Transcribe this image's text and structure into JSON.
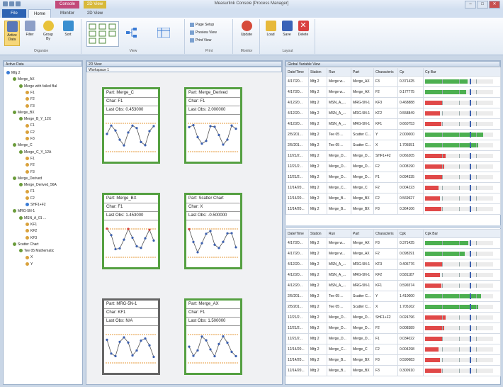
{
  "app": {
    "title": "Measurlink Console [Process Manager]",
    "context_tabs": [
      {
        "label": "Console",
        "color": "#c24a7a"
      },
      {
        "label": "2D View",
        "color": "#d8b93a"
      }
    ]
  },
  "tabs": [
    "File",
    "Home",
    "Monitor",
    "2D View"
  ],
  "ribbon": {
    "groups": [
      {
        "label": "Organize",
        "buttons": [
          "Active Data",
          "Filter",
          "Group By",
          "Sort"
        ]
      },
      {
        "label": "View",
        "buttons": []
      },
      {
        "label": "Print",
        "buttons": [
          "Page Setup",
          "Preview View",
          "Print View"
        ]
      },
      {
        "label": "Monitor",
        "buttons": [
          "Update"
        ]
      },
      {
        "label": "Layout",
        "buttons": [
          "Load",
          "Save",
          "Delete"
        ]
      }
    ]
  },
  "left_panel": {
    "title": "Active Data",
    "tree": [
      {
        "label": "Mfg 2",
        "level": 0,
        "color": "#3a7bd5"
      },
      {
        "label": "Merge_AX",
        "level": 1,
        "color": "#6a9b3a"
      },
      {
        "label": "Merge with failed Bal",
        "level": 2,
        "color": "#6a9b3a"
      },
      {
        "label": "F1",
        "level": 3,
        "color": "#d9a13b"
      },
      {
        "label": "F2",
        "level": 3,
        "color": "#d9a13b"
      },
      {
        "label": "F3",
        "level": 3,
        "color": "#d9a13b"
      },
      {
        "label": "Merge_BX",
        "level": 1,
        "color": "#6a9b3a"
      },
      {
        "label": "Merge_B_Y_12X",
        "level": 2,
        "color": "#6a9b3a"
      },
      {
        "label": "F1",
        "level": 3,
        "color": "#d9a13b"
      },
      {
        "label": "F2",
        "level": 3,
        "color": "#d9a13b"
      },
      {
        "label": "F3",
        "level": 3,
        "color": "#d9a13b"
      },
      {
        "label": "Merge_C",
        "level": 1,
        "color": "#6a9b3a"
      },
      {
        "label": "Merge_C_Y_12A",
        "level": 2,
        "color": "#6a9b3a"
      },
      {
        "label": "F1",
        "level": 3,
        "color": "#d9a13b"
      },
      {
        "label": "F2",
        "level": 3,
        "color": "#d9a13b"
      },
      {
        "label": "F3",
        "level": 3,
        "color": "#d9a13b"
      },
      {
        "label": "Merge_Derived",
        "level": 1,
        "color": "#6a9b3a"
      },
      {
        "label": "Merge_Derived_56A",
        "level": 2,
        "color": "#6a9b3a"
      },
      {
        "label": "F1",
        "level": 3,
        "color": "#d9a13b"
      },
      {
        "label": "F2",
        "level": 3,
        "color": "#d9a13b"
      },
      {
        "label": "SHF1+F2",
        "level": 3,
        "color": "#3a7bd5"
      },
      {
        "label": "MRG-5N-1",
        "level": 1,
        "color": "#6a9b3a"
      },
      {
        "label": "MSN_A_01 ...",
        "level": 2,
        "color": "#6a9b3a"
      },
      {
        "label": "KF1",
        "level": 3,
        "color": "#d9a13b"
      },
      {
        "label": "KF2",
        "level": 3,
        "color": "#d9a13b"
      },
      {
        "label": "KF3",
        "level": 3,
        "color": "#d9a13b"
      },
      {
        "label": "Scatter Chart",
        "level": 1,
        "color": "#6a9b3a"
      },
      {
        "label": "Tee 05 Mathematic",
        "level": 2,
        "color": "#6a9b3a"
      },
      {
        "label": "X",
        "level": 3,
        "color": "#d9a13b"
      },
      {
        "label": "Y",
        "level": 3,
        "color": "#d9a13b"
      }
    ]
  },
  "mid_panel": {
    "title": "2D View",
    "subtitle": "Workspace 1",
    "cards": [
      {
        "part": "Part: Merge_C",
        "char": "Char: F1",
        "last": "Last Obs: 0.453000",
        "border": "green"
      },
      {
        "part": "Part: Merge_Derived",
        "char": "Char: F1",
        "last": "Last Obs: 2.000000",
        "border": "green"
      },
      {
        "part": "Part: Merge_BX",
        "char": "Char: F1",
        "last": "Last Obs: 1.453000",
        "border": "green"
      },
      {
        "part": "Part: Scatter Chart",
        "char": "Char: X",
        "last": "Last Obs: -0.500000",
        "border": "green"
      },
      {
        "part": "Part: MRG-5N-1",
        "char": "Char: KF1",
        "last": "Last Obs: N/A",
        "border": "gray"
      },
      {
        "part": "Part: Merge_AX",
        "char": "Char: F1",
        "last": "Last Obs: 1.500000",
        "border": "green"
      }
    ]
  },
  "right_panel": {
    "title": "Global Variable View",
    "columns": [
      "Date/Time",
      "Station",
      "Run",
      "Part",
      "Characteris",
      "Cp",
      "Cp Bar"
    ],
    "columns_bottom": [
      "Date/Time",
      "Station",
      "Run",
      "Part",
      "Characteris",
      "Cpk",
      "Cpk Bar"
    ],
    "top_rows": [
      [
        "4/17/20...",
        "Mfg 2",
        "Merge w...",
        "Merge_AX",
        "F3",
        "0.371425",
        0.62,
        "#4caf50"
      ],
      [
        "4/17/20...",
        "Mfg 2",
        "Merge w...",
        "Merge_AX",
        "F2",
        "0.177775",
        0.6,
        "#4caf50"
      ],
      [
        "4/12/20...",
        "Mfg 2",
        "MSN_A_...",
        "MRG-5N-1",
        "KF3",
        "0.468888",
        0.25,
        "#e04848"
      ],
      [
        "4/12/20...",
        "Mfg 2",
        "MSN_A_...",
        "MRG-5N-1",
        "KF2",
        "0.558849",
        0.22,
        "#e04848"
      ],
      [
        "4/12/20...",
        "Mfg 2",
        "MSN_A_...",
        "MRG-5N-1",
        "KF1",
        "0.660753",
        0.24,
        "#e04848"
      ],
      [
        "2/5/201...",
        "Mfg 2",
        "Tee 05 ...",
        "Scatter C...",
        "Y",
        "2.000000",
        0.85,
        "#4caf50"
      ],
      [
        "2/5/201...",
        "Mfg 2",
        "Tee 05 ...",
        "Scatter C...",
        "X",
        "1.705551",
        0.78,
        "#4caf50"
      ],
      [
        "12/21/2...",
        "Mfg 2",
        "Merge_D...",
        "Merge_D...",
        "SHF1+F2",
        "0.066205",
        0.3,
        "#e04848"
      ],
      [
        "12/21/2...",
        "Mfg 2",
        "Merge_D...",
        "Merge_D...",
        "F2",
        "0.008190",
        0.28,
        "#e04848"
      ],
      [
        "12/21/2...",
        "Mfg 2",
        "Merge_D...",
        "Merge_D...",
        "F1",
        "0.094335",
        0.26,
        "#e04848"
      ],
      [
        "12/14/20...",
        "Mfg 2",
        "Merge_C...",
        "Merge_C",
        "F2",
        "0.004223",
        0.2,
        "#e04848"
      ],
      [
        "12/14/20...",
        "Mfg 2",
        "Merge_B...",
        "Merge_BX",
        "F2",
        "0.569927",
        0.22,
        "#e04848"
      ],
      [
        "12/14/20...",
        "Mfg 2",
        "Merge_B...",
        "Merge_BX",
        "F3",
        "0.364106",
        0.24,
        "#e04848"
      ]
    ],
    "bottom_rows": [
      [
        "4/17/20...",
        "Mfg 2",
        "Merge w...",
        "Merge_AX",
        "F3",
        "0.371425",
        0.64,
        "#4caf50"
      ],
      [
        "4/17/20...",
        "Mfg 2",
        "Merge w...",
        "Merge_AX",
        "F2",
        "0.098291",
        0.58,
        "#4caf50"
      ],
      [
        "4/12/20...",
        "Mfg 2",
        "MSN_A_...",
        "MRG-5N-1",
        "KF3",
        "0.405776",
        0.25,
        "#e04848"
      ],
      [
        "4/12/20...",
        "Mfg 2",
        "MSN_A_...",
        "MRG-5N-1",
        "KF2",
        "0.581187",
        0.22,
        "#e04848"
      ],
      [
        "4/12/20...",
        "Mfg 2",
        "MSN_A_...",
        "MRG-5N-1",
        "KF1",
        "0.596574",
        0.24,
        "#e04848"
      ],
      [
        "2/5/201...",
        "Mfg 2",
        "Tee 05 ...",
        "Scatter C...",
        "Y",
        "1.410000",
        0.82,
        "#4caf50"
      ],
      [
        "2/5/201...",
        "Mfg 2",
        "Tee 05 ...",
        "Scatter C...",
        "X",
        "1.705162",
        0.78,
        "#4caf50"
      ],
      [
        "12/21/2...",
        "Mfg 2",
        "Merge_D...",
        "Merge_D...",
        "SHF1+F2",
        "0.024796",
        0.3,
        "#e04848"
      ],
      [
        "12/21/2...",
        "Mfg 2",
        "Merge_D...",
        "Merge_D...",
        "F2",
        "0.008389",
        0.28,
        "#e04848"
      ],
      [
        "12/21/2...",
        "Mfg 2",
        "Merge_D...",
        "Merge_D...",
        "F1",
        "0.034022",
        0.26,
        "#e04848"
      ],
      [
        "12/14/20...",
        "Mfg 2",
        "Merge_C...",
        "Merge_C",
        "F2",
        "0.004298",
        0.2,
        "#e04848"
      ],
      [
        "12/14/20...",
        "Mfg 2",
        "Merge_B...",
        "Merge_BX",
        "F3",
        "0.590683",
        0.22,
        "#e04848"
      ],
      [
        "12/14/20...",
        "Mfg 2",
        "Merge_B...",
        "Merge_BX",
        "F3",
        "0.300910",
        0.24,
        "#e04848"
      ]
    ]
  }
}
